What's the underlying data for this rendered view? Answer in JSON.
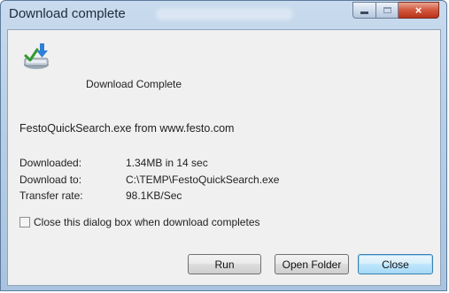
{
  "window": {
    "title": "Download complete",
    "caption_buttons": {
      "minimize": "minimize",
      "maximize": "maximize",
      "close": "×"
    }
  },
  "header": {
    "icon": "download-complete-icon",
    "text": "Download Complete"
  },
  "file_line": "FestoQuickSearch.exe from www.festo.com",
  "info": [
    {
      "label": "Downloaded:",
      "value": "1.34MB in 14 sec"
    },
    {
      "label": "Download to:",
      "value": "C:\\TEMP\\FestoQuickSearch.exe"
    },
    {
      "label": "Transfer rate:",
      "value": "98.1KB/Sec"
    }
  ],
  "close_on_complete": {
    "label": "Close this dialog box when download completes",
    "checked": false
  },
  "buttons": {
    "run": "Run",
    "open_folder": "Open Folder",
    "close": "Close"
  },
  "colors": {
    "title_bar": "#b8cfe6",
    "close_button": "#d2573c",
    "default_button_border": "#3c7fb1",
    "dialog_background": "#f0f0f0"
  }
}
